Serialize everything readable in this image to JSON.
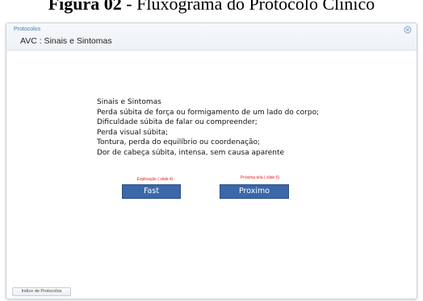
{
  "caption": {
    "label": "Figura 02",
    "rest": " - Fluxograma do Protocolo Clínico"
  },
  "window": {
    "app_title": "Protocolos",
    "screen_title": "AVC : Sinais e Sintomas",
    "close_icon": "close-circle-icon"
  },
  "content": {
    "lines": [
      "Sinais e Sintomas",
      "Perda súbita de força ou formigamento de um lado do corpo;",
      "Dificuldade súbita de falar ou compreender;",
      "Perda visual súbita;",
      "Tontura, perda do equilíbrio ou coordenação;",
      "Dor de cabeça súbita, intensa, sem causa aparente"
    ]
  },
  "actions": {
    "fast_hint": "Explicação ( slide 4)",
    "fast_label": "Fast",
    "next_hint": "Próxima tela ( slide 5)",
    "next_label": "Proximo"
  },
  "footer": {
    "index_label": "Indice de Protocolos"
  },
  "colors": {
    "button_bg": "#3a68a8",
    "hint_text": "#e02020",
    "app_title": "#4a78b0"
  }
}
